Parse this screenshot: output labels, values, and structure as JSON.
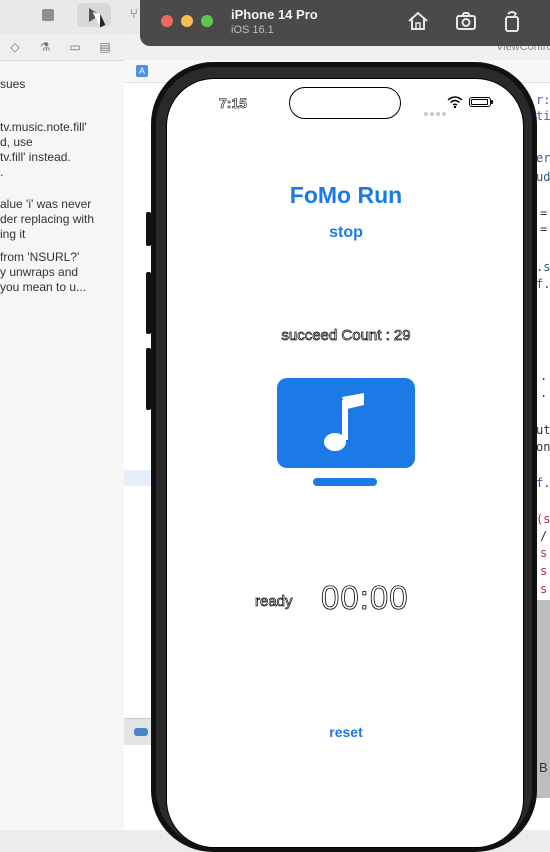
{
  "xcode": {
    "issues_header": "sues",
    "issues": [
      {
        "lines": [
          "tv.music.note.fill'",
          "d, use",
          "tv.fill' instead."
        ]
      },
      {
        "lines": [
          "alue 'i' was never",
          "der replacing with",
          "ing it"
        ]
      },
      {
        "lines": [
          "from 'NSURL?'",
          "y unwraps and",
          "you mean to u..."
        ]
      }
    ],
    "editor_tab_fragment": "ViewContro",
    "code_fragments": [
      "r:",
      "ti",
      "er",
      "ud",
      "=",
      "=",
      ".s",
      "f.",
      ".",
      ".",
      "ut",
      "on",
      "f.",
      "(s",
      "/",
      "s",
      "s",
      "s"
    ]
  },
  "simulator": {
    "device_name": "iPhone 14 Pro",
    "os_version": "iOS 16.1"
  },
  "phone": {
    "status_time": "7:15"
  },
  "app": {
    "title": "FoMo Run",
    "stop_label": "stop",
    "count_text": "succeed Count : 29",
    "status_label": "ready",
    "timer": "00:00",
    "reset_label": "reset",
    "accent_color": "#1b7ae6",
    "icon": "tv-music-note-fill-icon"
  },
  "right_panel": {
    "label": "B"
  }
}
